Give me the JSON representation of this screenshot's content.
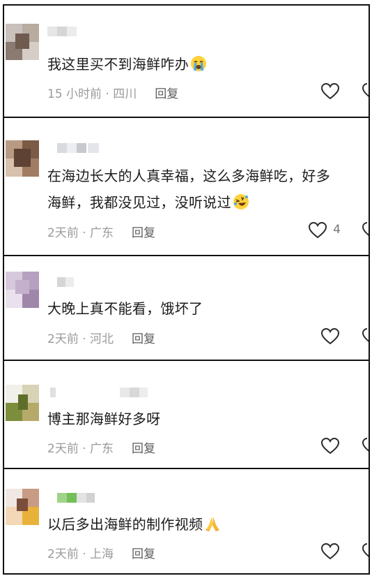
{
  "comments": [
    {
      "text": "我这里买不到海鲜咋办",
      "emoji": "loudly-crying-face",
      "time": "15 小时前",
      "location": "四川",
      "reply_label": "回复",
      "likes": ""
    },
    {
      "text_line1": "在海边长大的人真幸福，这么多海鲜吃，好多",
      "text_line2": "海鲜，我都没见过，没听说过",
      "emoji": "rolling-laughing-face",
      "time": "2天前",
      "location": "广东",
      "reply_label": "回复",
      "likes": "4"
    },
    {
      "text": "大晚上真不能看，饿坏了",
      "time": "2天前",
      "location": "河北",
      "reply_label": "回复",
      "likes": ""
    },
    {
      "text": "博主那海鲜好多呀",
      "time": "2天前",
      "location": "广东",
      "reply_label": "回复",
      "likes": ""
    },
    {
      "text": "以后多出海鲜的制作视频",
      "emoji": "folded-hands",
      "time": "2天前",
      "location": "上海",
      "reply_label": "回复",
      "likes": ""
    }
  ],
  "separator": " · ",
  "colors": {
    "text": "#1b1b1b",
    "meta": "#9a9a9a",
    "border": "#111111"
  }
}
